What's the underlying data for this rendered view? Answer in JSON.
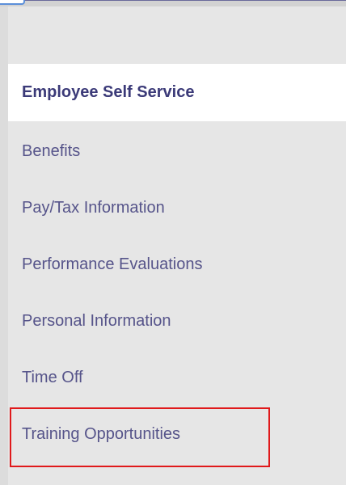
{
  "menu": {
    "header": "Employee Self Service",
    "items": [
      {
        "label": "Benefits"
      },
      {
        "label": "Pay/Tax Information"
      },
      {
        "label": "Performance Evaluations"
      },
      {
        "label": "Personal Information"
      },
      {
        "label": "Time Off"
      },
      {
        "label": "Training Opportunities"
      }
    ]
  },
  "colors": {
    "header_text": "#3b3a78",
    "item_text": "#56548a",
    "panel_background": "#e6e6e6",
    "highlight_border": "#e0191b"
  }
}
